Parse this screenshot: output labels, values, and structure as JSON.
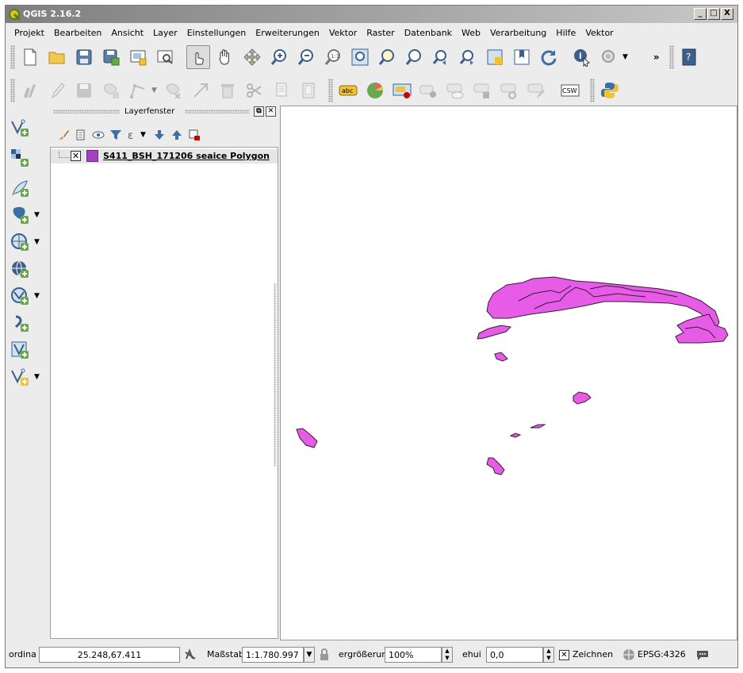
{
  "window": {
    "title": "QGIS 2.16.2",
    "controls": {
      "minimize": "_",
      "maximize": "□",
      "close": "X"
    }
  },
  "menu": [
    "Projekt",
    "Bearbeiten",
    "Ansicht",
    "Layer",
    "Einstellungen",
    "Erweiterungen",
    "Vektor",
    "Raster",
    "Datenbank",
    "Web",
    "Verarbeitung",
    "Hilfe",
    "Vektor"
  ],
  "toolbar1": {
    "icons": [
      "new-project-icon",
      "open-project-icon",
      "save-project-icon",
      "save-as-icon",
      "new-print-composer-icon",
      "composer-manager-icon",
      "touch-zoom-pan-icon",
      "pan-icon",
      "pan-to-selection-icon",
      "zoom-in-icon",
      "zoom-out-icon",
      "zoom-native-icon",
      "zoom-full-icon",
      "zoom-to-selection-icon",
      "zoom-to-layer-icon",
      "zoom-last-icon",
      "zoom-next-icon",
      "new-map-view-icon",
      "new-bookmark-icon",
      "refresh-icon",
      "identify-icon",
      "select-feature-icon",
      "help-icon"
    ],
    "overflow_label": "»"
  },
  "toolbar2": {
    "icons": [
      "current-edits-icon",
      "toggle-editing-icon",
      "save-layer-edits-icon",
      "add-feature-icon",
      "node-tool-icon",
      "delete-selected-icon",
      "cut-features-icon",
      "copy-features-icon",
      "paste-features-icon",
      "label-tool-icon",
      "diagram-tool-icon",
      "highlight-pinned-labels-icon",
      "pin-labels-icon",
      "show-hide-labels-icon",
      "move-label-icon",
      "rotate-label-icon",
      "change-label-icon",
      "csw-icon",
      "python-console-icon"
    ],
    "label_text": "abc",
    "csw_text": "CSW"
  },
  "left_toolbar": [
    "add-vector-layer-icon",
    "add-raster-layer-icon",
    "add-delimited-text-layer-icon",
    "add-postgis-layer-icon",
    "add-wms-layer-icon",
    "add-wcs-layer-icon",
    "add-spatialite-layer-icon",
    "add-mssql-layer-icon",
    "add-virtual-layer-icon",
    "new-shapefile-layer-icon"
  ],
  "layer_panel": {
    "title": "Layerfenster",
    "layers": [
      {
        "name": "S411_BSH_171206 seaice Polygon",
        "visible": true,
        "color": "#a63fc2"
      }
    ]
  },
  "map": {
    "fill_color": "#e65ce6",
    "stroke_color": "#3a1a3a"
  },
  "status_bar": {
    "coord_label": "ordina",
    "coord_value": "25.248,67.411",
    "scale_label": "Maßstab",
    "scale_value": "1:1.780.997",
    "magnifier_label": "ergrößerun",
    "magnifier_value": "100%",
    "rotation_label": "ehui",
    "rotation_value": "0,0",
    "render_label": "Zeichnen",
    "render_checked": true,
    "crs": "EPSG:4326"
  }
}
